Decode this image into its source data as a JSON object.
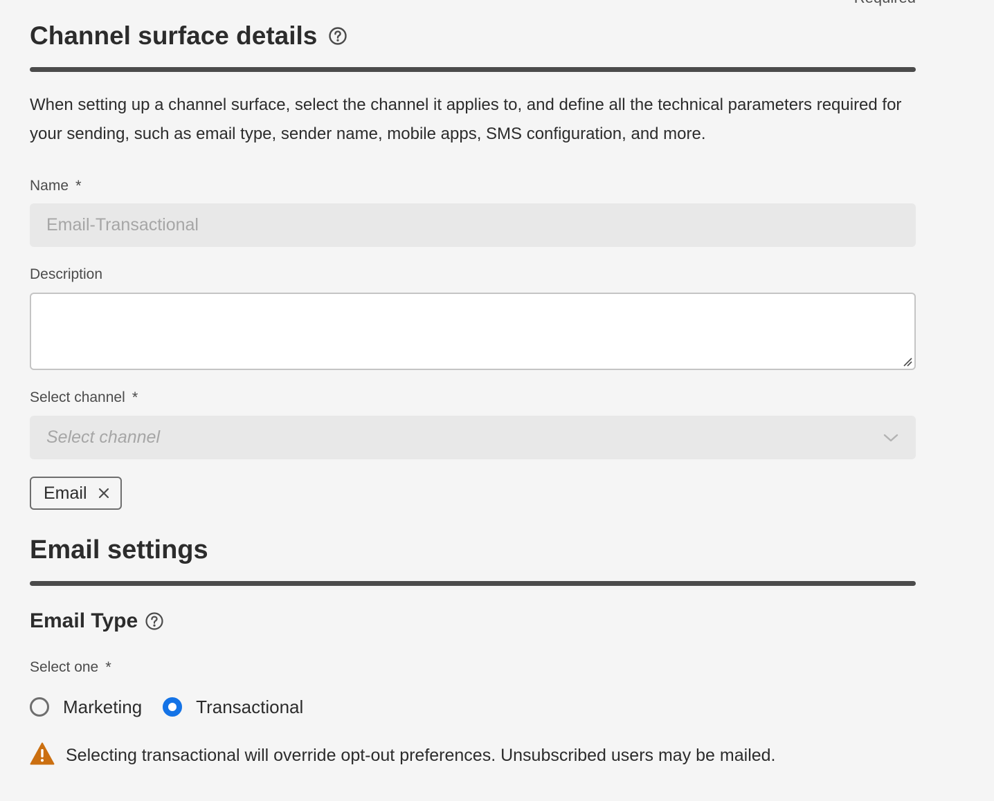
{
  "header": {
    "required_note": "Required",
    "title": "Channel surface details",
    "help_icon": "question-circle-icon",
    "intro": "When setting up a channel surface, select the channel it applies to, and define all the technical parameters required for your sending, such as email type, sender name, mobile apps, SMS configuration, and more."
  },
  "form": {
    "name_label": "Name",
    "required_marker": "*",
    "name_value": "Email-Transactional",
    "description_label": "Description",
    "description_value": "",
    "channel_label": "Select channel",
    "channel_placeholder": "Select channel",
    "selected_tags": [
      {
        "label": "Email"
      }
    ]
  },
  "email_settings": {
    "title": "Email settings",
    "email_type_title": "Email Type",
    "select_one_label": "Select one",
    "options": [
      {
        "label": "Marketing",
        "checked": false
      },
      {
        "label": "Transactional",
        "checked": true
      }
    ],
    "warning_icon": "alert-triangle-icon",
    "warning_text": "Selecting transactional will override opt-out preferences. Unsubscribed users may be mailed."
  },
  "colors": {
    "accent": "#1473e6",
    "warning": "#cb6f10",
    "rule": "#4b4b4b",
    "background": "#f5f5f5"
  }
}
